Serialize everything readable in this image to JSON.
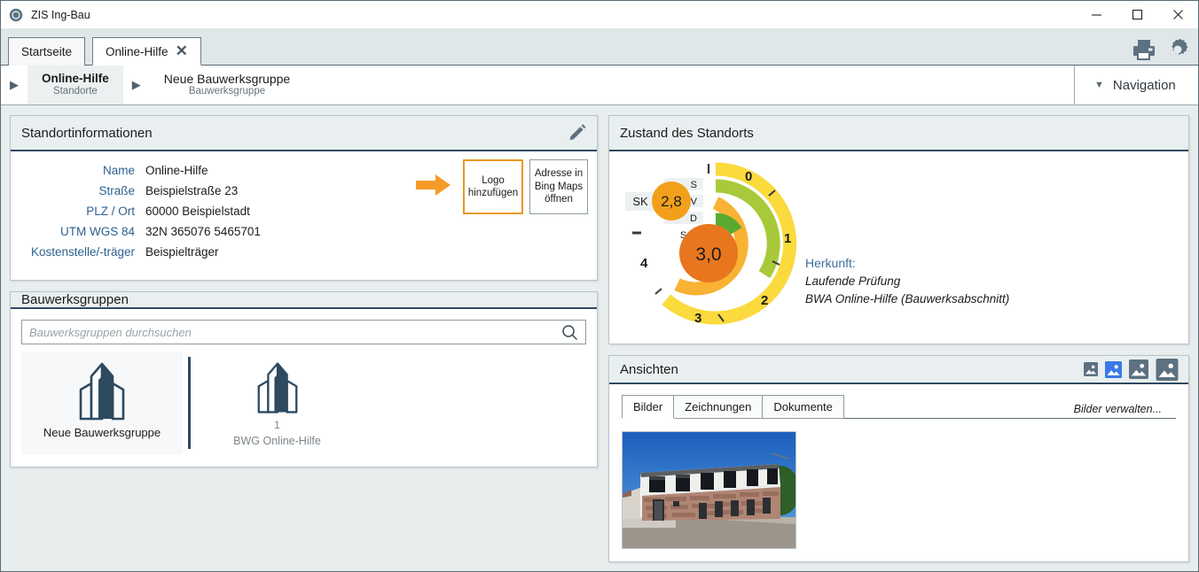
{
  "window": {
    "title": "ZIS Ing-Bau",
    "app_icon": "app-circle-icon",
    "minimize": "–",
    "maximize": "□",
    "close": "✕"
  },
  "tabs": [
    {
      "label": "Startseite",
      "active": false,
      "closable": false
    },
    {
      "label": "Online-Hilfe",
      "active": true,
      "closable": true,
      "close_glyph": "✕"
    }
  ],
  "tab_tools": [
    {
      "name": "print-icon",
      "label": "Drucken"
    },
    {
      "name": "gear-icon",
      "label": "Einstellungen"
    }
  ],
  "breadcrumb": {
    "arrow_glyph": "▶",
    "items": [
      {
        "title": "Online-Hilfe",
        "subtitle": "Standorte",
        "selected": true
      },
      {
        "title": "Neue Bauwerksgruppe",
        "subtitle": "Bauwerksgruppe",
        "selected": false
      }
    ],
    "navigation": {
      "label": "Navigation",
      "caret": "▼"
    }
  },
  "standort": {
    "title": "Standortinformationen",
    "edit_icon": "pencil-icon",
    "fields": [
      {
        "label": "Name",
        "value": "Online-Hilfe"
      },
      {
        "label": "Straße",
        "value": "Beispielstraße 23"
      },
      {
        "label": "PLZ / Ort",
        "value": "60000 Beispielstadt"
      },
      {
        "label": "UTM WGS 84",
        "value": "32N 365076 5465701"
      },
      {
        "label": "Kostenstelle/-träger",
        "value": "Beispielträger"
      }
    ],
    "logo_button": "Logo hinzufügen",
    "bing_button": "Adresse in Bing Maps öffnen",
    "arrow_color": "#f59b28",
    "logo_border_color": "#e8981f"
  },
  "bauwerksgruppen": {
    "title": "Bauwerksgruppen",
    "search_placeholder": "Bauwerksgruppen durchsuchen",
    "search_value": "",
    "search_icon": "search-icon",
    "tiles": [
      {
        "label": "Neue Bauwerksgruppe",
        "number": "",
        "sub": "",
        "selected": true
      },
      {
        "label": "",
        "number": "1",
        "sub": "BWG Online-Hilfe",
        "selected": false
      }
    ]
  },
  "zustand": {
    "title": "Zustand des Standorts",
    "sk_label": "SK",
    "sk_value": "2,8",
    "center_value": "3,0",
    "dash": "–",
    "ring_labels": [
      "S",
      "V",
      "D",
      "Sch"
    ],
    "scale_labels": [
      "0",
      "1",
      "2",
      "3",
      "4"
    ],
    "herkunft_title": "Herkunft:",
    "herkunft_lines": [
      "Laufende Prüfung",
      "BWA Online-Hilfe (Bauwerksabschnitt)"
    ],
    "colors": {
      "sk_badge": "#f2a01b",
      "center": "#e8761e",
      "ring_s": "#fada3c",
      "ring_v": "#a8c93a",
      "ring_d": "#f9b233",
      "ring_sch": "#5aaa32"
    }
  },
  "chart_data": {
    "type": "gauge",
    "title": "Zustand des Standorts",
    "scale_min": 0,
    "scale_max": 4,
    "tick_labels": [
      "0",
      "1",
      "2",
      "3",
      "4"
    ],
    "center_value": 3.0,
    "center_value_label": "3,0",
    "sk_value": 2.8,
    "sk_value_label": "2,8",
    "sk_label": "SK",
    "series": [
      {
        "name": "S",
        "label": "S",
        "value": 2.9,
        "color": "#fada3c",
        "ring": 0
      },
      {
        "name": "V",
        "label": "V",
        "value": 1.9,
        "color": "#a8c93a",
        "ring": 1
      },
      {
        "name": "D",
        "label": "D",
        "value": 3.5,
        "color": "#f9b233",
        "ring": 2
      },
      {
        "name": "Sch",
        "label": "Sch",
        "value": 0.8,
        "color": "#5aaa32",
        "ring": 3
      }
    ],
    "annotations": [
      "Herkunft:",
      "Laufende Prüfung",
      "BWA Online-Hilfe (Bauwerksabschnitt)"
    ]
  },
  "ansichten": {
    "title": "Ansichten",
    "size_icons": [
      {
        "name": "image-size-xs-icon",
        "selected": false
      },
      {
        "name": "image-size-s-icon",
        "selected": true
      },
      {
        "name": "image-size-m-icon",
        "selected": false
      },
      {
        "name": "image-size-l-icon",
        "selected": false
      }
    ],
    "tabs": [
      {
        "label": "Bilder",
        "active": true
      },
      {
        "label": "Zeichnungen",
        "active": false
      },
      {
        "label": "Dokumente",
        "active": false
      }
    ],
    "manage_link": "Bilder verwalten...",
    "thumbnail_alt": "building-photo"
  }
}
